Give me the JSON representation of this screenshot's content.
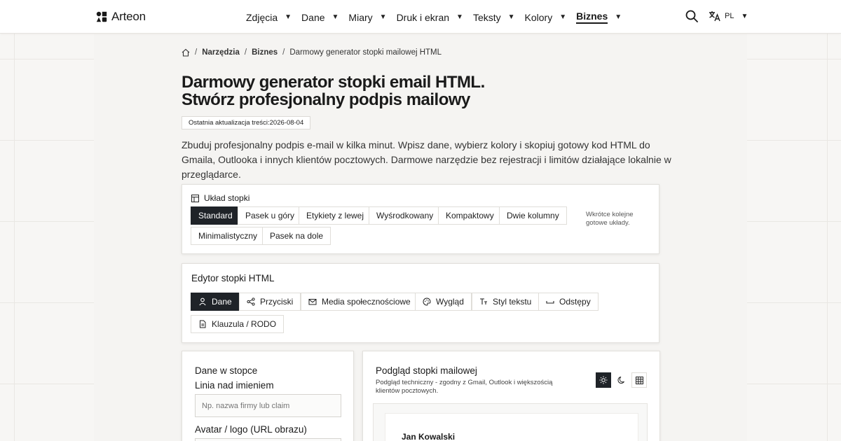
{
  "header": {
    "brand": "Arteon",
    "nav": [
      {
        "label": "Zdjęcia"
      },
      {
        "label": "Dane"
      },
      {
        "label": "Miary"
      },
      {
        "label": "Druk i ekran"
      },
      {
        "label": "Teksty"
      },
      {
        "label": "Kolory"
      },
      {
        "label": "Biznes",
        "active": true
      }
    ],
    "lang_code": "PL",
    "icons": {
      "search": "search-icon",
      "language": "translate-icon",
      "caret": "caret-down-icon"
    }
  },
  "breadcrumb": {
    "items": [
      "Narzędzia",
      "Biznes"
    ],
    "current": "Darmowy generator stopki mailowej HTML",
    "separator": "/"
  },
  "page": {
    "title_line1": "Darmowy generator stopki email HTML.",
    "title_line2": "Stwórz profesjonalny podpis mailowy",
    "updated_label": "Ostatnia aktualizacja treści:",
    "updated_date": "2026-08-04",
    "lead": "Zbuduj profesjonalny podpis e-mail w kilka minut. Wpisz dane, wybierz kolory i skopiuj gotowy kod HTML do Gmaila, Outlooka i innych klientów pocztowych. Darmowe narzędzie bez rejestracji i limitów działające lokalnie w przeglądarce."
  },
  "layout_card": {
    "title": "Układ stopki",
    "options": [
      "Standard",
      "Pasek u góry",
      "Etykiety z lewej",
      "Wyśrodkowany",
      "Kompaktowy",
      "Dwie kolumny",
      "Minimalistyczny",
      "Pasek na dole"
    ],
    "selected": "Standard",
    "soon_note": "Wkrótce kolejne gotowe układy."
  },
  "editor_card": {
    "title": "Edytor stopki HTML",
    "tabs": [
      "Dane",
      "Przyciski",
      "Media społecznościowe",
      "Wygląd",
      "Styl tekstu",
      "Odstępy",
      "Klauzula / RODO"
    ],
    "active_tab": "Dane"
  },
  "data_card": {
    "title": "Dane w stopce",
    "fields": [
      {
        "label": "Linia nad imieniem",
        "placeholder": "Np. nazwa firmy lub claim"
      },
      {
        "label": "Avatar / logo (URL obrazu)",
        "placeholder": ""
      }
    ]
  },
  "preview_card": {
    "title": "Podgląd stopki mailowej",
    "subtitle": "Podgląd techniczny - zgodny z Gmail, Outlook i większością klientów pocztowych.",
    "modes": [
      "sun-icon",
      "moon-icon",
      "grid-icon"
    ],
    "active_mode": "sun-icon",
    "signature_name": "Jan Kowalski"
  },
  "colors": {
    "accent": "#1f2328",
    "background": "#f5f4f2"
  }
}
